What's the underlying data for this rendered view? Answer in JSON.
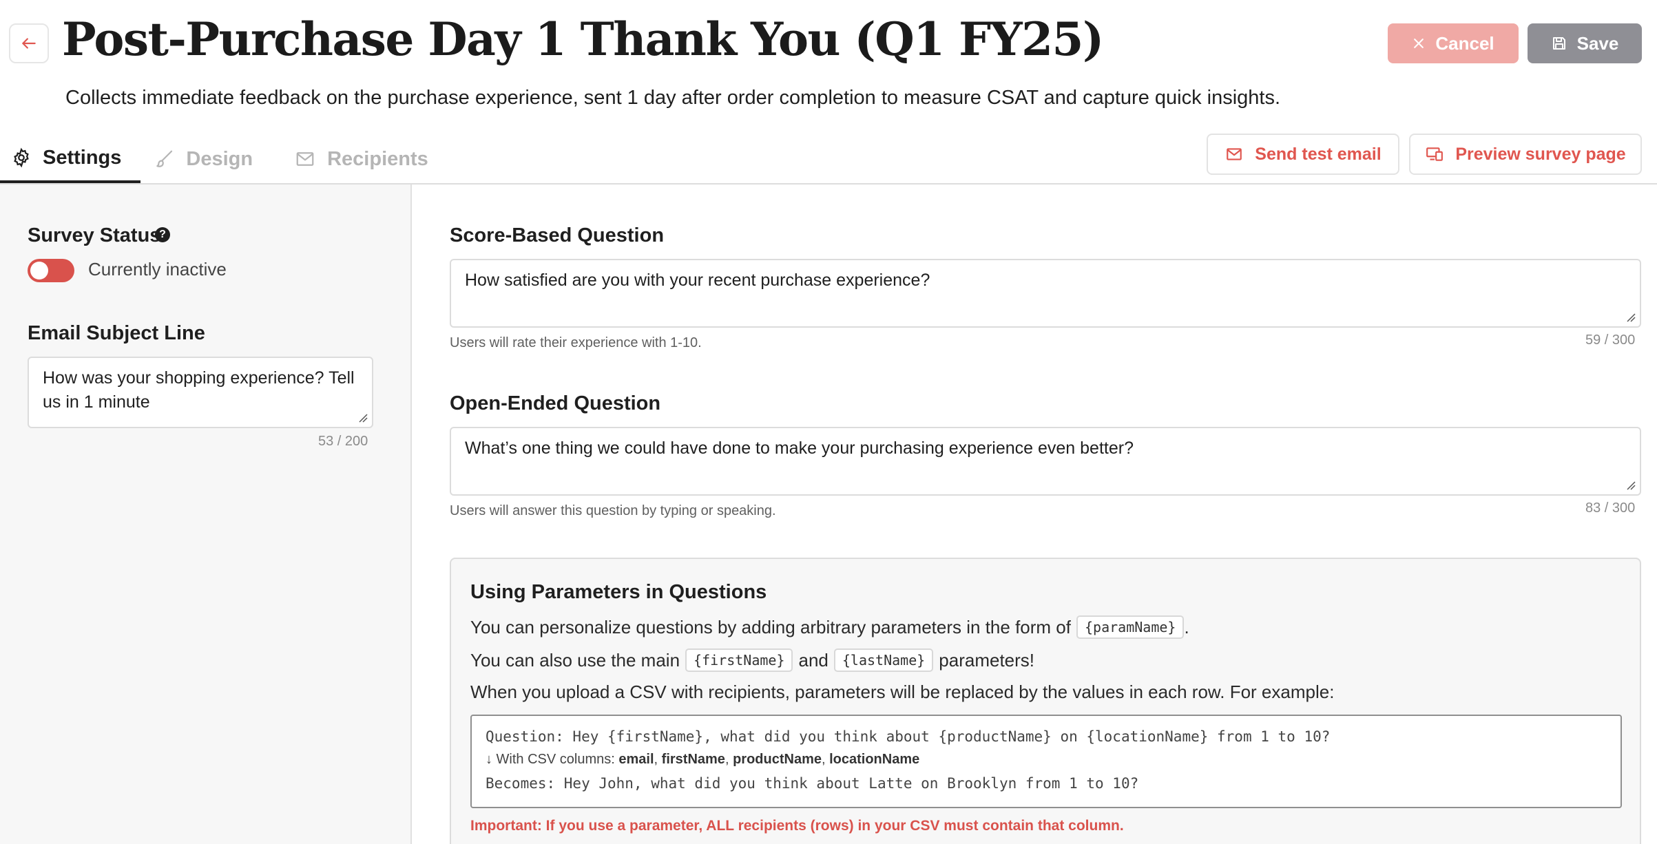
{
  "header": {
    "title": "Post-Purchase Day 1 Thank You (Q1 FY25)",
    "description": "Collects immediate feedback on the purchase experience, sent 1 day after order completion to measure CSAT and capture quick insights.",
    "back_icon": "arrow-left-icon",
    "cancel_label": "Cancel",
    "save_label": "Save"
  },
  "tabs": [
    {
      "label": "Settings",
      "icon": "gear-icon",
      "active": true
    },
    {
      "label": "Design",
      "icon": "brush-icon",
      "active": false
    },
    {
      "label": "Recipients",
      "icon": "mail-icon",
      "active": false
    }
  ],
  "actions": {
    "send_test_label": "Send test email",
    "preview_label": "Preview survey page"
  },
  "left": {
    "status_label": "Survey Status",
    "status_help": "?",
    "status_text": "Currently inactive",
    "status_active": false,
    "subject_label": "Email Subject Line",
    "subject_value": "How was your shopping experience? Tell us in 1 minute",
    "subject_counter": "53 / 200"
  },
  "score_question": {
    "label": "Score-Based Question",
    "value": "How satisfied are you with your recent purchase experience?",
    "hint": "Users will rate their experience with 1-10.",
    "counter": "59 / 300"
  },
  "open_question": {
    "label": "Open-Ended Question",
    "value": "What’s one thing we could have done to make your purchasing experience even better?",
    "hint": "Users will answer this question by typing or speaking.",
    "counter": "83 / 300"
  },
  "params": {
    "title": "Using Parameters in Questions",
    "line1_text": "You can personalize questions by adding arbitrary parameters in the form of",
    "line1_code": "{paramName}",
    "line1_end": ".",
    "line2_text": "You can also use the main",
    "line2_code1": "{firstName}",
    "line2_and": "and",
    "line2_code2": "{lastName}",
    "line2_end": "parameters!",
    "line3_text": "When you upload a CSV with recipients, parameters will be replaced by the values in each row. For example:",
    "example_question": "Question: Hey {firstName}, what did you think about {productName} on {locationName} from 1 to 10?",
    "example_csv_prefix": "↓ With CSV columns:",
    "example_csv_cols": [
      "email",
      "firstName",
      "productName",
      "locationName"
    ],
    "example_becomes": "Becomes: Hey John, what did you think about Latte on Brooklyn from 1 to 10?",
    "important": "Important: If you use a parameter, ALL recipients (rows) in your CSV must contain that column."
  },
  "colors": {
    "accent": "#e0564f",
    "cancel_bg": "#f0a9a5",
    "save_bg": "#8f8f95",
    "toggle_off": "#d9524c"
  }
}
